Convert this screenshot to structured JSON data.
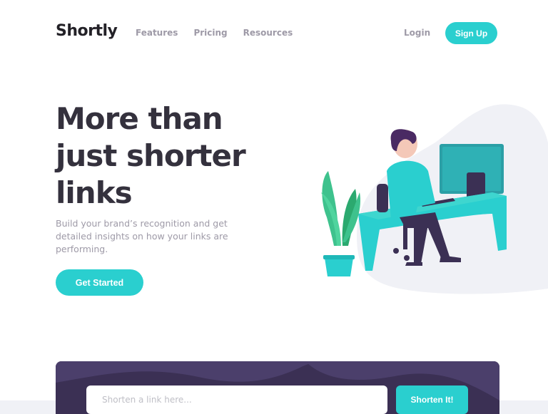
{
  "header": {
    "logo": "Shortly",
    "nav": [
      "Features",
      "Pricing",
      "Resources"
    ],
    "login_label": "Login",
    "signup_label": "Sign Up"
  },
  "hero": {
    "title_lines": [
      "More than",
      "just shorter",
      "links"
    ],
    "description": "Build your brand’s recognition and get detailed insights on how your links are performing.",
    "cta_label": "Get Started"
  },
  "shorten": {
    "placeholder": "Shorten a link here...",
    "button_label": "Shorten It!"
  },
  "colors": {
    "accent": "#2acfcf",
    "dark_violet": "#3b3054",
    "heading": "#34313d",
    "gray_text": "#9e9aa7"
  }
}
